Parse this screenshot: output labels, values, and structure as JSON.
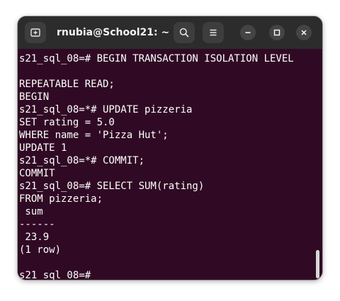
{
  "window": {
    "title": "rnubia@School21: ~"
  },
  "icons": {
    "new_tab": "new-tab-icon",
    "search": "search-icon",
    "menu": "hamburger-menu-icon",
    "minimize": "minimize-icon",
    "maximize": "maximize-icon",
    "close": "close-icon"
  },
  "colors": {
    "terminal_background": "#300a24",
    "titlebar_background": "#2c2c2c",
    "text": "#ffffff"
  },
  "terminal": {
    "lines": [
      "s21_sql_08=# BEGIN TRANSACTION ISOLATION LEVEL",
      "",
      "REPEATABLE READ;",
      "BEGIN",
      "s21_sql_08=*# UPDATE pizzeria",
      "SET rating = 5.0",
      "WHERE name = 'Pizza Hut';",
      "UPDATE 1",
      "s21_sql_08=*# COMMIT;",
      "COMMIT",
      "s21_sql_08=# SELECT SUM(rating)",
      "FROM pizzeria;",
      " sum",
      "------",
      " 23.9",
      "(1 row)",
      "",
      "s21_sql_08=#"
    ]
  }
}
